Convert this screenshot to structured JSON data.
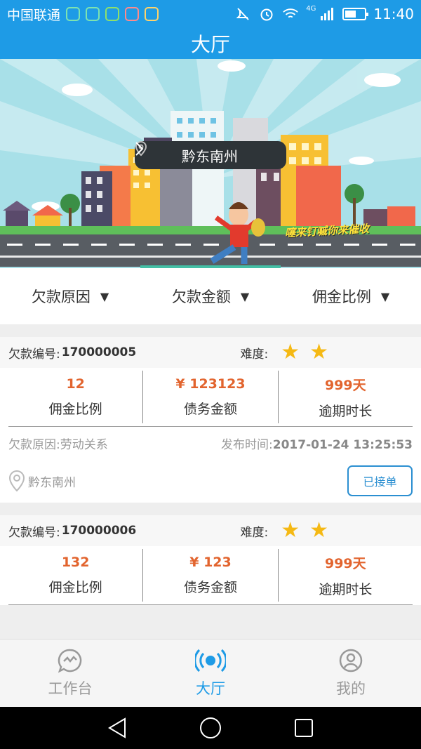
{
  "status_bar": {
    "carrier": "中国联通",
    "network": "4G",
    "time": "11:40",
    "battery_level": 0.55
  },
  "header": {
    "title": "大厅"
  },
  "banner": {
    "location": "黔东南州",
    "slogan": "噻来钉嘁你来催收"
  },
  "filters": [
    {
      "label": "欠款原因"
    },
    {
      "label": "欠款金额"
    },
    {
      "label": "佣金比例"
    }
  ],
  "cards": [
    {
      "no_label": "欠款编号:",
      "no_value": "170000005",
      "difficulty_label": "难度:",
      "stars": 2,
      "stats": [
        {
          "value": "12",
          "label": "佣金比例"
        },
        {
          "value": "¥ 123123",
          "label": "债务金额"
        },
        {
          "value": "999天",
          "label": "逾期时长"
        }
      ],
      "reason": "欠款原因:劳动关系",
      "time_label": "发布时间:",
      "time_value": "2017-01-24 13:25:53",
      "location": "黔东南州",
      "status": "已接单"
    },
    {
      "no_label": "欠款编号:",
      "no_value": "170000006",
      "difficulty_label": "难度:",
      "stars": 2,
      "stats": [
        {
          "value": "132",
          "label": "佣金比例"
        },
        {
          "value": "¥ 123",
          "label": "债务金额"
        },
        {
          "value": "999天",
          "label": "逾期时长"
        }
      ]
    }
  ],
  "tabs": [
    {
      "label": "工作台",
      "icon": "chat-pulse-icon",
      "active": false
    },
    {
      "label": "大厅",
      "icon": "broadcast-icon",
      "active": true
    },
    {
      "label": "我的",
      "icon": "user-icon",
      "active": false
    }
  ],
  "colors": {
    "primary": "#1e9be6",
    "accent": "#e2642e",
    "star": "#f5b914"
  }
}
